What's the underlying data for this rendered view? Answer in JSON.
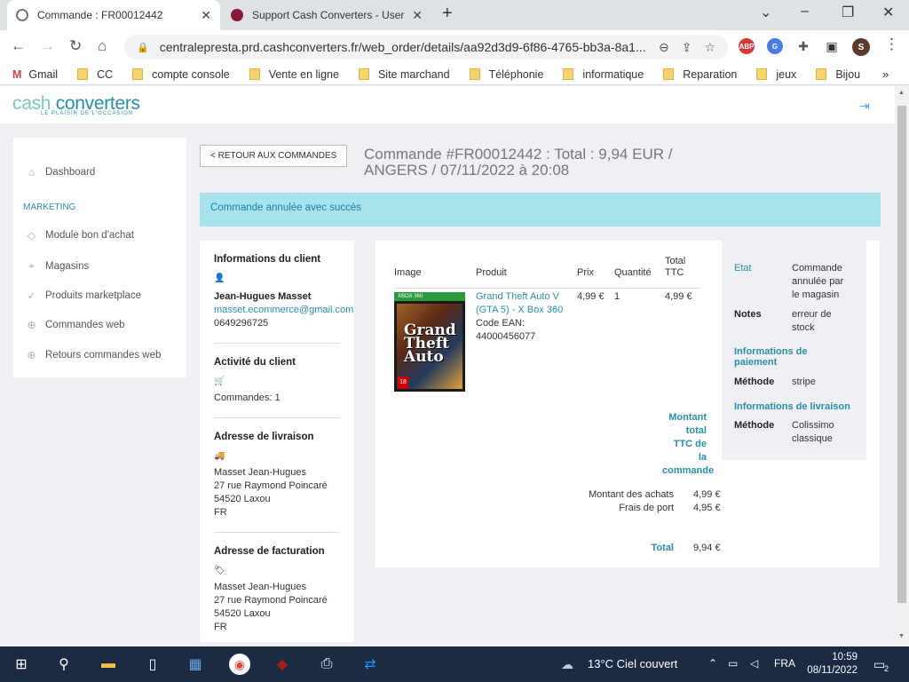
{
  "browser": {
    "tabs": [
      {
        "title": "Commande : FR00012442",
        "active": true
      },
      {
        "title": "Support Cash Converters - User N",
        "active": false
      }
    ],
    "url": "centralepresta.prd.cashconverters.fr/web_order/details/aa92d3d9-6f86-4765-bb3a-8a1...",
    "profile_initial": "S",
    "extensions": [
      "ABP"
    ],
    "bookmarks": [
      "Gmail",
      "CC",
      "compte console",
      "Vente en ligne",
      "Site marchand",
      "Téléphonie",
      "informatique",
      "Reparation",
      "jeux",
      "Bijou"
    ]
  },
  "header": {
    "logo_text_a": "cash ",
    "logo_text_b": "converters",
    "logo_tagline": "LE PLAISIR DE L'OCCASION"
  },
  "sidebar": {
    "dashboard": "Dashboard",
    "section": "MARKETING",
    "items": [
      "Module bon d'achat",
      "Magasins",
      "Produits marketplace",
      "Commandes web",
      "Retours commandes web"
    ]
  },
  "order": {
    "back_label": "< RETOUR AUX COMMANDES",
    "title": "Commande #FR00012442 : Total : 9,94 EUR / ANGERS / 07/11/2022 à 20:08",
    "alert": "Commande annulée avec succès"
  },
  "client": {
    "info_title": "Informations du client",
    "name": "Jean-Hugues Masset",
    "email": "masset.ecommerce@gmail.com",
    "phone": "0649296725",
    "activity_title": "Activité du client",
    "orders": "Commandes: 1",
    "shipping_title": "Adresse de livraison",
    "shipping": [
      "Masset Jean-Hugues",
      "27 rue Raymond Poincaré",
      "54520 Laxou",
      "FR"
    ],
    "billing_title": "Adresse de facturation",
    "billing": [
      "Masset Jean-Hugues",
      "27 rue Raymond Poincaré",
      "54520 Laxou",
      "FR"
    ]
  },
  "products": {
    "headers": {
      "image": "Image",
      "product": "Produit",
      "price": "Prix",
      "qty": "Quantité",
      "total_a": "Total",
      "total_b": "TTC"
    },
    "rows": [
      {
        "name_a": "Grand Theft Auto V",
        "name_b": "(GTA 5) - X Box 360",
        "ean_label": "Code EAN:",
        "ean": "44000456077",
        "price": "4,99 €",
        "qty": "1",
        "total": "4,99 €",
        "platform": "XBOX 360",
        "cover_title": "Grand Theft Auto",
        "rating": "18"
      }
    ],
    "total_label": [
      "Montant",
      "total",
      "TTC de",
      "la",
      "commande"
    ],
    "purchases_label": "Montant des achats",
    "purchases": "4,99 €",
    "shipping_label": "Frais de port",
    "shipping": "4,95 €",
    "grand_label": "Total",
    "grand": "9,94 €"
  },
  "status": {
    "etat_label": "Etat",
    "etat": [
      "Commande",
      "annulée par",
      "le magasin"
    ],
    "notes_label": "Notes",
    "notes": [
      "erreur de",
      "stock"
    ],
    "payment_title_a": "Informations de",
    "payment_title_b": "paiement",
    "payment_method_label": "Méthode",
    "payment_method": "stripe",
    "delivery_title": "Informations de livraison",
    "delivery_method_label": "Méthode",
    "delivery_method": [
      "Colissimo",
      "classique"
    ]
  },
  "taskbar": {
    "weather": "13°C  Ciel couvert",
    "lang": "FRA",
    "time": "10:59",
    "date": "08/11/2022",
    "notifications": "2"
  },
  "colors": {
    "accent": "#2b8ea8",
    "alert_bg": "#a6e3ec",
    "taskbar": "#1d2a44"
  }
}
